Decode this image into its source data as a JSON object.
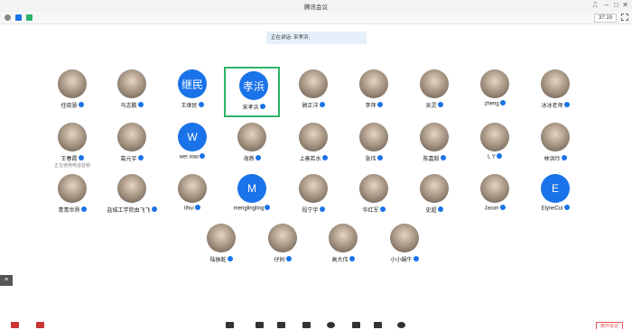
{
  "window": {
    "title": "腾讯会议"
  },
  "toolbar": {
    "timer": "37:19"
  },
  "speaking": {
    "label": "正在讲话: 宋孝浜;"
  },
  "participants": [
    {
      "name": "任晓慧",
      "avatar": "photo"
    },
    {
      "name": "马志鹏",
      "avatar": "photo"
    },
    {
      "name": "王继民",
      "avatar": "blue",
      "avatar_text": "继民"
    },
    {
      "name": "宋孝浜",
      "avatar": "blue",
      "avatar_text": "孝浜",
      "active": true
    },
    {
      "name": "顾正洋",
      "avatar": "photo"
    },
    {
      "name": "李萍",
      "avatar": "photo"
    },
    {
      "name": "吴灵",
      "avatar": "photo"
    },
    {
      "name": "zheng",
      "avatar": "photo"
    },
    {
      "name": "冰冰老师",
      "avatar": "photo"
    },
    {
      "name": "王春霞",
      "avatar": "photo",
      "sub": "正在使用电话音频"
    },
    {
      "name": "葛元宇",
      "avatar": "photo"
    },
    {
      "name": "wei xiao",
      "avatar": "blue",
      "avatar_text": "W"
    },
    {
      "name": "海燕",
      "avatar": "photo"
    },
    {
      "name": "上善若水",
      "avatar": "photo"
    },
    {
      "name": "张伟",
      "avatar": "photo"
    },
    {
      "name": "陈嘉毅",
      "avatar": "photo"
    },
    {
      "name": "L Y",
      "avatar": "photo"
    },
    {
      "name": "林洪玲",
      "avatar": "photo"
    },
    {
      "name": "青青世界",
      "avatar": "photo"
    },
    {
      "name": "盐城工学院由飞飞",
      "avatar": "photo"
    },
    {
      "name": "lihui",
      "avatar": "photo"
    },
    {
      "name": "menglingling",
      "avatar": "blue",
      "avatar_text": "M"
    },
    {
      "name": "段宁宇",
      "avatar": "photo"
    },
    {
      "name": "华红军",
      "avatar": "photo"
    },
    {
      "name": "史超",
      "avatar": "photo"
    },
    {
      "name": "Jason",
      "avatar": "photo"
    },
    {
      "name": "ElyneCui",
      "avatar": "blue",
      "avatar_text": "E"
    },
    {
      "name": "陆振乾",
      "avatar": "photo"
    },
    {
      "name": "仔妈",
      "avatar": "photo"
    },
    {
      "name": "高大伟",
      "avatar": "photo"
    },
    {
      "name": "小小蜗牛",
      "avatar": "photo"
    }
  ],
  "bottom": {
    "leave_label": "离开会议"
  },
  "colors": {
    "accent": "#1a73e8",
    "active_border": "#2db36a"
  }
}
